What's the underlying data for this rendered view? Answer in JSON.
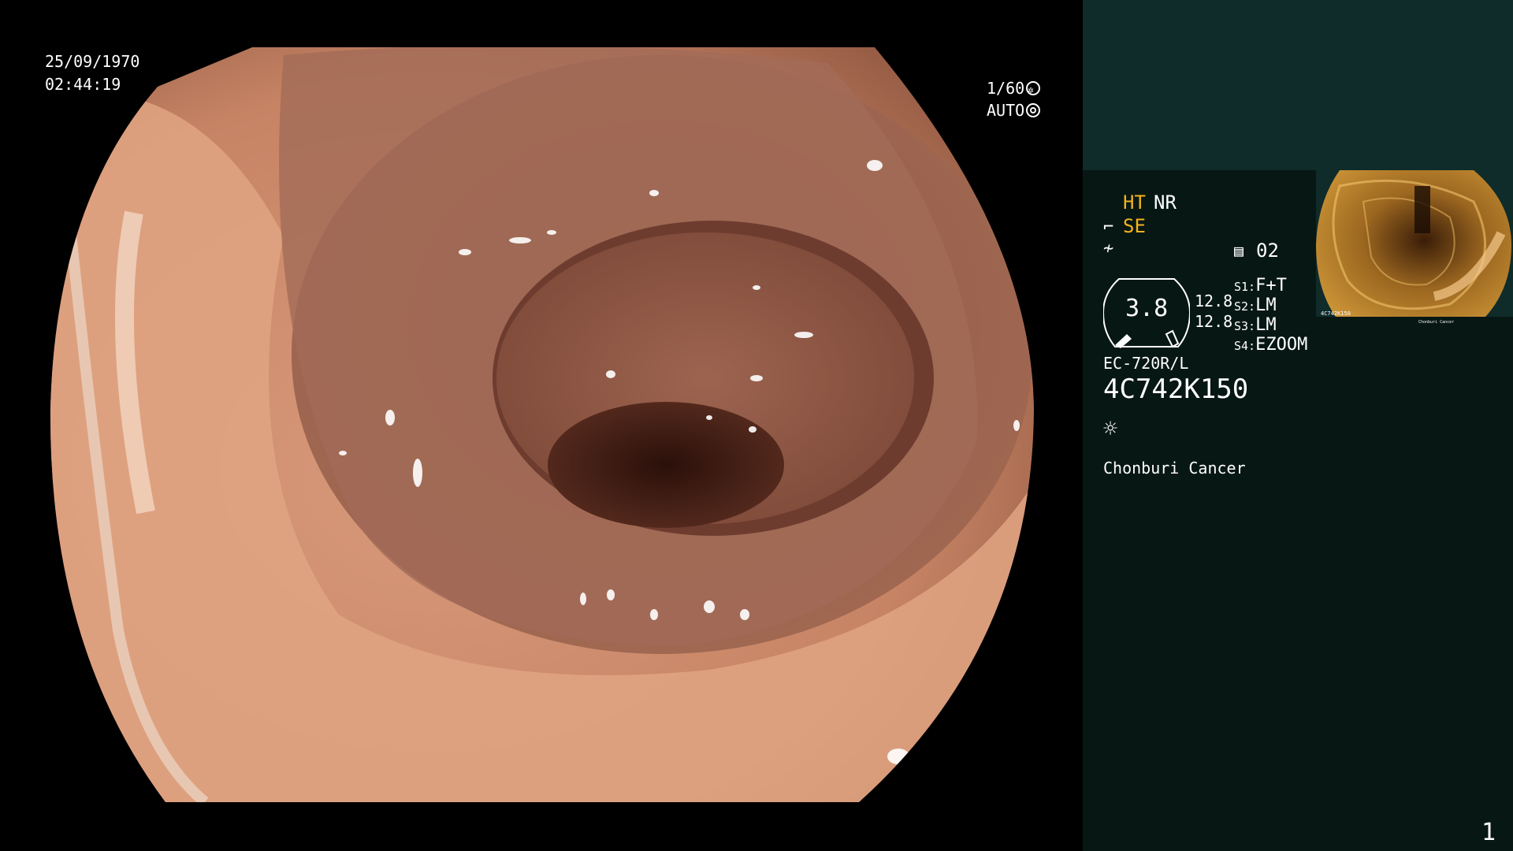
{
  "overlay": {
    "date": "25/09/1970",
    "time": "02:44:19",
    "shutter": "1/60",
    "iris": "AUTO"
  },
  "panel": {
    "mode_ht": "HT",
    "mode_nr": "NR",
    "mode_se": "SE",
    "memory_label": "02",
    "gauge_value": "3.8",
    "gain_1": "12.8",
    "gain_2": "12.8",
    "switches": [
      {
        "key": "S1:",
        "value": "F+T"
      },
      {
        "key": "S2:",
        "value": "LM"
      },
      {
        "key": "S3:",
        "value": "LM"
      },
      {
        "key": "S4:",
        "value": "EZOOM"
      }
    ],
    "scope_model": "EC-720R/L",
    "serial": "4C742K150",
    "institution": "Chonburi Cancer",
    "page_number": "1"
  },
  "thumbnail": {
    "serial": "4C742K150",
    "institution": "Chonburi Cancer"
  },
  "colors": {
    "accent_yellow": "#f3b21c",
    "panel_dark": "#071714",
    "panel_header": "#0f2b2a",
    "tissue": "#b56f57"
  },
  "icons": [
    "shutter-icon",
    "iris-icon",
    "light-icon",
    "memory-icon",
    "scope-icon",
    "curve-icon"
  ]
}
